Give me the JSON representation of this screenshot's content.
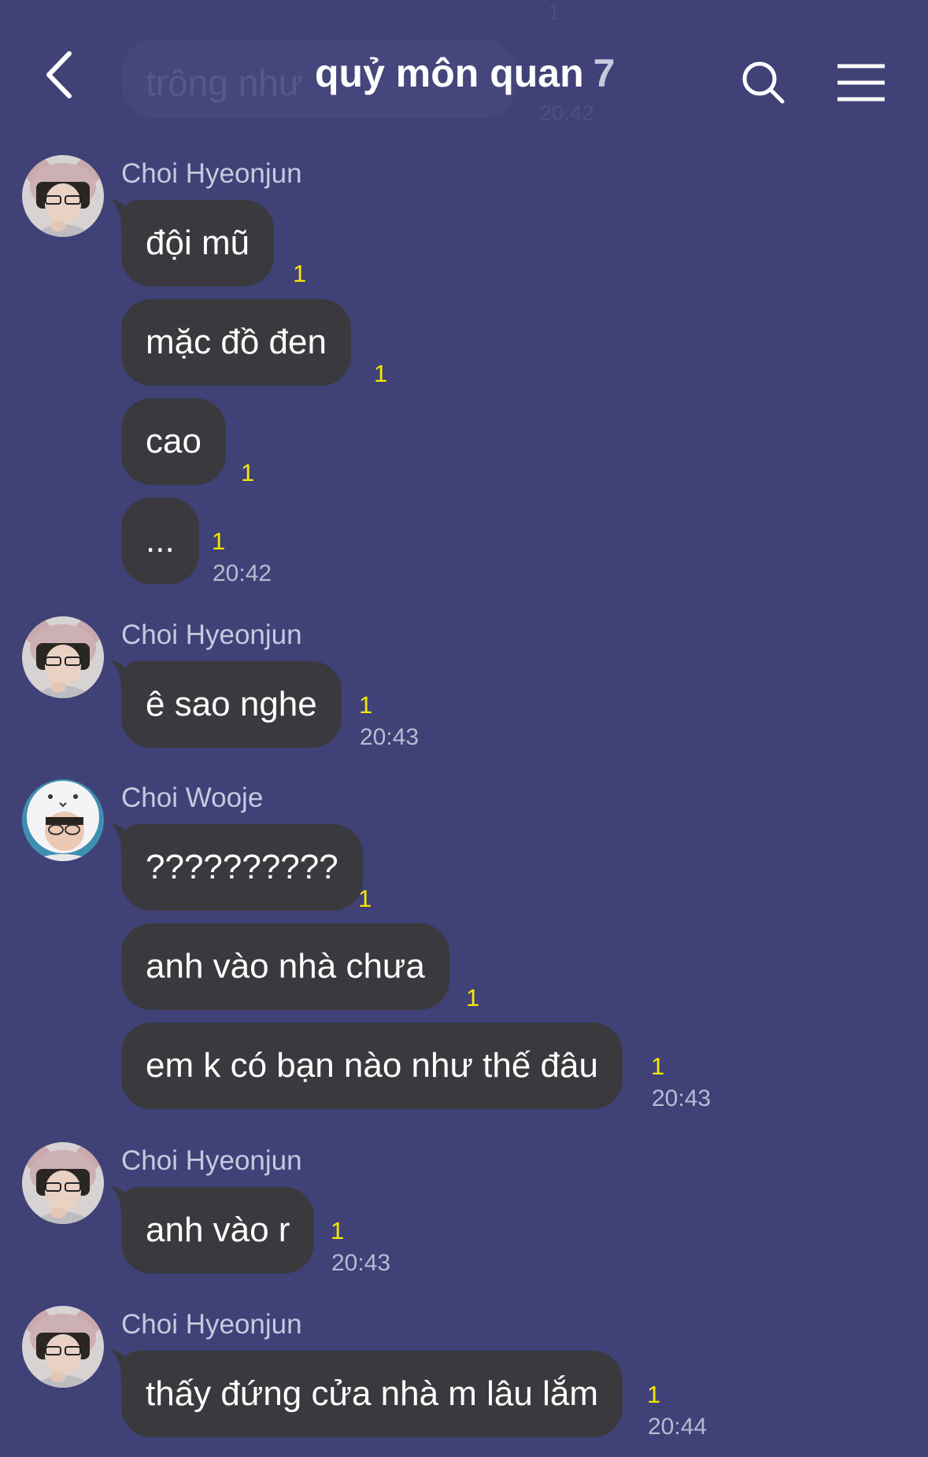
{
  "header": {
    "title": "quỷ môn quan",
    "member_count": "7",
    "ghost_preview_text": "trông như",
    "ghost_preview_time": "20:42",
    "ghost_preview_unread": "1"
  },
  "messages": [
    {
      "sender": "Choi Hyeonjun",
      "text": "đội mũ",
      "unread": "1",
      "time": ""
    },
    {
      "sender": "",
      "text": "mặc đồ đen",
      "unread": "1",
      "time": ""
    },
    {
      "sender": "",
      "text": "cao",
      "unread": "1",
      "time": ""
    },
    {
      "sender": "",
      "text": "...",
      "unread": "1",
      "time": "20:42"
    },
    {
      "sender": "Choi Hyeonjun",
      "text": "ê sao nghe",
      "unread": "1",
      "time": "20:43"
    },
    {
      "sender": "Choi Wooje",
      "text": "??????????",
      "unread": "1",
      "time": ""
    },
    {
      "sender": "",
      "text": "anh vào nhà chưa",
      "unread": "1",
      "time": ""
    },
    {
      "sender": "",
      "text": "em k có bạn nào như thế đâu",
      "unread": "1",
      "time": "20:43"
    },
    {
      "sender": "Choi Hyeonjun",
      "text": "anh vào r",
      "unread": "1",
      "time": "20:43"
    },
    {
      "sender": "Choi Hyeonjun",
      "text": "thấy đứng cửa nhà m lâu lắm",
      "unread": "1",
      "time": "20:44"
    }
  ],
  "colors": {
    "background": "#3f4177",
    "bubble": "#3a3a3e",
    "unread": "#f7e600",
    "sender": "#c7c9df",
    "time": "#b9bad2"
  }
}
